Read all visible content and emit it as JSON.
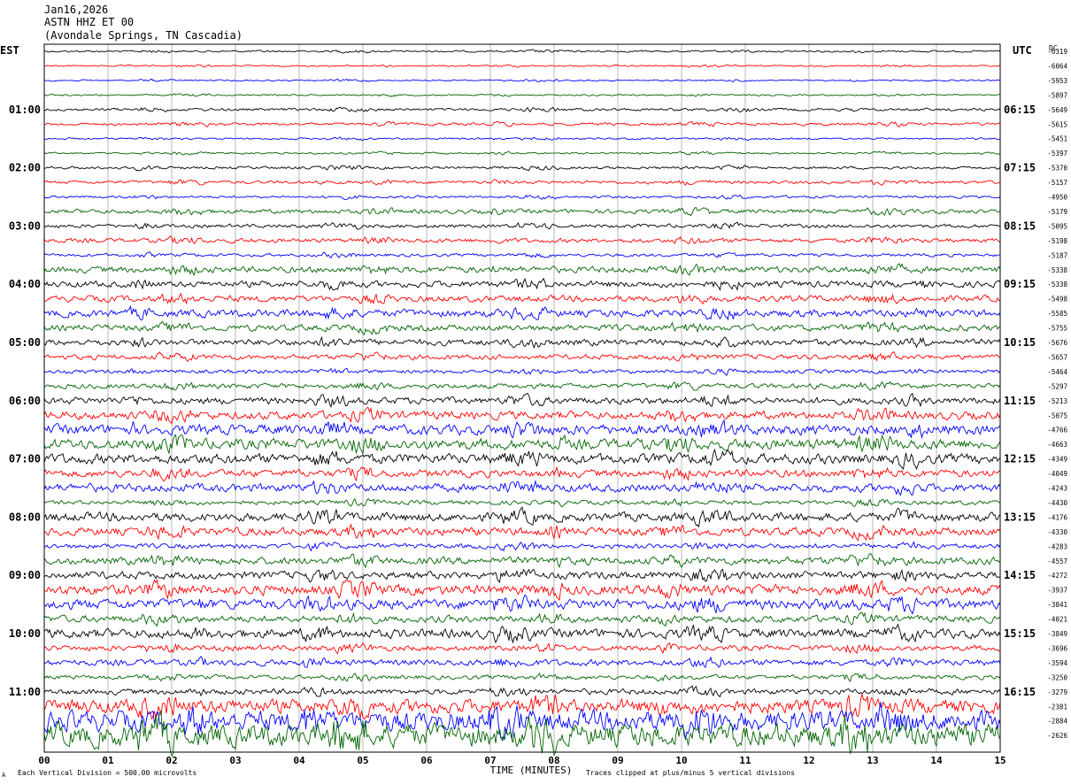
{
  "header": {
    "date": "Jan16,2026",
    "station": "ASTN HHZ ET 00",
    "location": "(Avondale Springs, TN Cascadia)"
  },
  "chart_data": {
    "type": "line",
    "title": "ASTN HHZ ET 00",
    "left_axis_label": "EST",
    "right_axis_label": "UTC",
    "dc_label": "DC",
    "xlabel": "TIME (MINUTES)",
    "x_ticks": [
      "00",
      "01",
      "02",
      "03",
      "04",
      "05",
      "06",
      "07",
      "08",
      "09",
      "10",
      "11",
      "12",
      "13",
      "14",
      "15"
    ],
    "est_hour_labels": [
      "01:00",
      "02:00",
      "03:00",
      "04:00",
      "05:00",
      "06:00",
      "07:00",
      "08:00",
      "09:00",
      "10:00",
      "11:00"
    ],
    "utc_hour_labels": [
      "06:15",
      "07:15",
      "08:15",
      "09:15",
      "10:15",
      "11:15",
      "12:15",
      "13:15",
      "14:15",
      "15:15",
      "16:15"
    ],
    "trace_colors": [
      "#000000",
      "#ff0000",
      "#0000ff",
      "#006400"
    ],
    "dc_offsets": [
      "-6319",
      "-6064",
      "-5953",
      "-5897",
      "-5649",
      "-5615",
      "-5451",
      "-5397",
      "-5370",
      "-5157",
      "-4950",
      "-5179",
      "-5095",
      "-5198",
      "-5187",
      "-5338",
      "-5338",
      "-5498",
      "-5585",
      "-5755",
      "-5676",
      "-5657",
      "-5464",
      "-5297",
      "-5213",
      "-5075",
      "-4766",
      "-4663",
      "-4349",
      "-4049",
      "-4243",
      "-4430",
      "-4176",
      "-4330",
      "-4283",
      "-4557",
      "-4272",
      "-3937",
      "-3841",
      "-4021",
      "-3849",
      "-3696",
      "-3594",
      "-3250",
      "-3279",
      "-2381",
      "-2884",
      "-2626"
    ],
    "trace_activity": [
      1.5,
      1.2,
      1.2,
      1.3,
      2.2,
      2.2,
      1.5,
      1.5,
      2.2,
      2.5,
      2.0,
      3.5,
      3.0,
      3.5,
      2.5,
      5.0,
      5.0,
      5.0,
      6.0,
      5.0,
      5.0,
      4.0,
      3.0,
      4.0,
      5.5,
      6.5,
      8.0,
      8.5,
      8.0,
      6.0,
      6.5,
      3.5,
      7.0,
      6.5,
      4.0,
      6.0,
      6.0,
      8.0,
      8.0,
      5.5,
      7.5,
      4.5,
      5.0,
      3.5,
      4.5,
      11.0,
      16.0,
      18.0
    ]
  },
  "footer": {
    "left_note": "Each Vertical Division =  500.00 microvolts",
    "right_note": "Traces clipped at plus/minus 5 vertical divisions",
    "corner_mark": "A"
  }
}
